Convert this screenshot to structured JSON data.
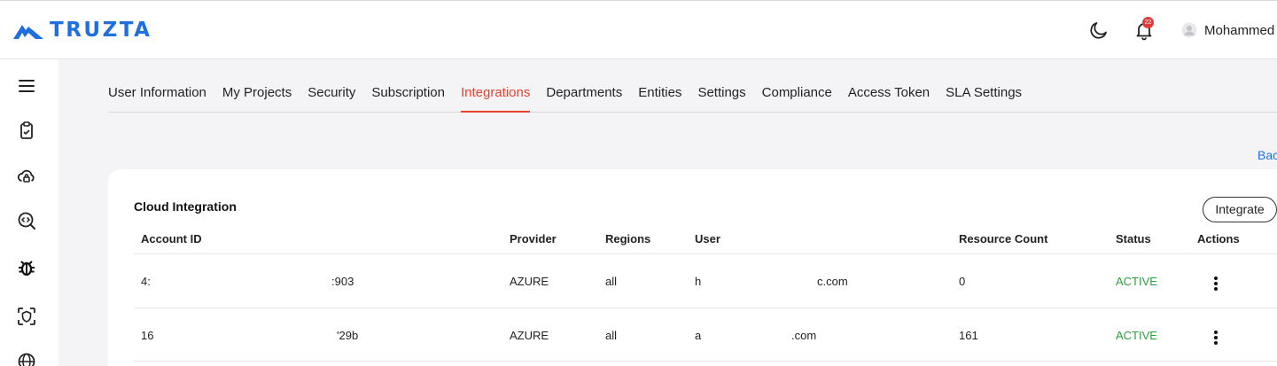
{
  "brand": {
    "name": "TRUZTA",
    "color": "#1f6fe0"
  },
  "header": {
    "username": "Mohammed",
    "notification_count": "22",
    "icons": [
      "moon-icon",
      "bell-icon",
      "avatar-icon"
    ]
  },
  "rail": {
    "icons": [
      "menu-icon",
      "clipboard-icon",
      "cloud-lock-icon",
      "code-search-icon",
      "bug-icon",
      "shield-scan-icon",
      "globe-icon"
    ]
  },
  "tabs": [
    {
      "label": "User Information"
    },
    {
      "label": "My Projects"
    },
    {
      "label": "Security"
    },
    {
      "label": "Subscription"
    },
    {
      "label": "Integrations",
      "active": true
    },
    {
      "label": "Departments"
    },
    {
      "label": "Entities"
    },
    {
      "label": "Settings"
    },
    {
      "label": "Compliance"
    },
    {
      "label": "Access Token"
    },
    {
      "label": "SLA Settings"
    }
  ],
  "back_label": "Bac",
  "cloud": {
    "title": "Cloud Integration",
    "integrate_label": "Integrate",
    "columns": [
      "Account ID",
      "Provider",
      "Regions",
      "User",
      "Resource Count",
      "Status",
      "Actions"
    ],
    "rows": [
      {
        "account_a": "4:",
        "account_b": ":903",
        "provider": "AZURE",
        "regions": "all",
        "user_a": "h",
        "user_b": "c.com",
        "resource_count": "0",
        "status": "ACTIVE"
      },
      {
        "account_a": "16",
        "account_b": "'29b",
        "provider": "AZURE",
        "regions": "all",
        "user_a": "a",
        "user_b": ".com",
        "resource_count": "161",
        "status": "ACTIVE"
      }
    ]
  },
  "colors": {
    "accent": "#e8432d",
    "status_active": "#2e9c3d",
    "link": "#1f6fe0"
  }
}
